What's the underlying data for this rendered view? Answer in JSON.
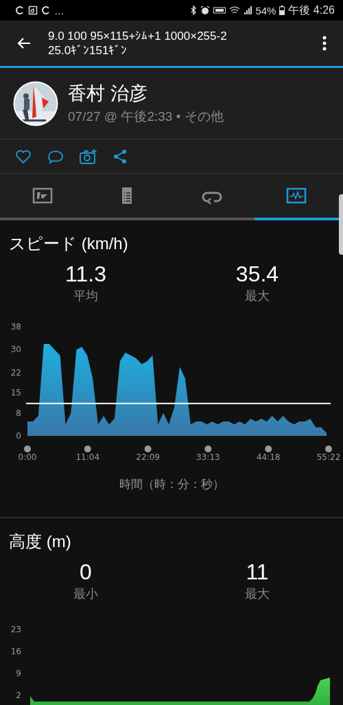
{
  "status_bar": {
    "overflow": "…",
    "battery": "54%",
    "time": "午後 4:26"
  },
  "app_bar": {
    "title": "9.0 100 95×115+ｼﾑ+1 1000×255-2 25.0ｷﾞﾝ151ｷﾞﾝ"
  },
  "activity": {
    "name": "香村 治彦",
    "meta": "07/27 @ 午後2:33 • その他"
  },
  "tabs": [
    {
      "kind": "summary",
      "selected": false
    },
    {
      "kind": "details",
      "selected": false
    },
    {
      "kind": "laps",
      "selected": false
    },
    {
      "kind": "charts",
      "selected": true
    }
  ],
  "sections": [
    {
      "title": "スピード (km/h)",
      "stats": [
        {
          "value": "11.3",
          "label": "平均"
        },
        {
          "value": "35.4",
          "label": "最大"
        }
      ],
      "xlabel": "時間（時：分：秒）",
      "chart_data": {
        "type": "area",
        "x": [
          0,
          1,
          2,
          3,
          4,
          5,
          6,
          7,
          8,
          9,
          10,
          11,
          12,
          13,
          14,
          15,
          16,
          17,
          18,
          19,
          20,
          21,
          22,
          23,
          24,
          25,
          26,
          27,
          28,
          29,
          30,
          31,
          32,
          33,
          34,
          35,
          36,
          37,
          38,
          39,
          40,
          41,
          42,
          43,
          44,
          45,
          46,
          47,
          48,
          49,
          50,
          51,
          52,
          53,
          54,
          55
        ],
        "series": [
          {
            "color": "#1eaee0",
            "values": [
              5,
              5,
              7,
              32,
              32,
              30,
              28,
              4,
              8,
              30,
              31,
              28,
              20,
              4,
              7,
              4,
              6,
              26,
              29,
              28,
              27,
              25,
              26,
              28,
              4,
              8,
              4,
              10,
              24,
              20,
              4,
              5,
              5,
              4,
              5,
              4,
              5,
              5,
              4,
              5,
              4,
              6,
              5,
              6,
              5,
              7,
              5,
              7,
              5,
              4,
              5,
              5,
              6,
              3,
              3,
              1
            ]
          }
        ],
        "xlim": [
          0,
          55.37
        ],
        "ylim": [
          0,
          38
        ],
        "yticks": [
          0,
          8,
          15,
          22,
          30,
          38
        ],
        "xticks": [
          {
            "value": 0,
            "label": "0:00"
          },
          {
            "value": 11.07,
            "label": "11:04"
          },
          {
            "value": 22.15,
            "label": "22:09"
          },
          {
            "value": 33.22,
            "label": "33:13"
          },
          {
            "value": 44.3,
            "label": "44:18"
          },
          {
            "value": 55.37,
            "label": "55:22"
          }
        ],
        "ref_lines": [
          {
            "axis": "y",
            "value": 11.3
          }
        ]
      }
    },
    {
      "title": "高度 (m)",
      "stats": [
        {
          "value": "0",
          "label": "最小"
        },
        {
          "value": "11",
          "label": "最大"
        }
      ],
      "profile_chart": {
        "axis_labels": [
          "23",
          "16",
          "9",
          "2"
        ]
      }
    }
  ]
}
